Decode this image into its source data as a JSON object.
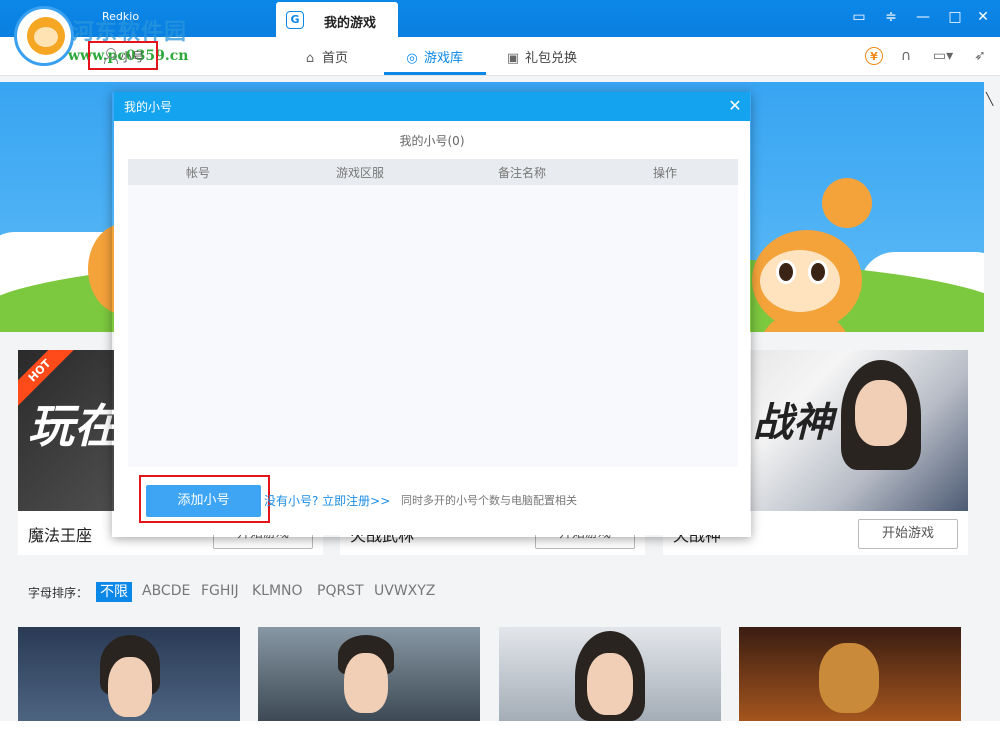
{
  "titlebar": {
    "app_name": "Redkio",
    "active_tab": "我的游戏",
    "tab_icon_letter": "G",
    "controls": [
      "▭",
      "≑",
      "—",
      "□",
      "✕"
    ]
  },
  "watermark": {
    "text": "河东软件园",
    "url": "www.pc0359.cn"
  },
  "navbar": {
    "sub_account": "小号",
    "items": [
      {
        "label": "首页",
        "icon": "home-icon"
      },
      {
        "label": "游戏库",
        "icon": "gamepad-icon"
      },
      {
        "label": "礼包兑换",
        "icon": "gift-icon"
      }
    ],
    "right_icons": [
      "coin-icon",
      "headset-icon",
      "monitor-icon",
      "rocket-icon"
    ],
    "coin_symbol": "¥"
  },
  "games": [
    {
      "title": "魔法王座",
      "button": "开始游戏",
      "badge": "HOT",
      "art_text": "玩在西"
    },
    {
      "title": "火战武林",
      "button": "开始游戏"
    },
    {
      "title": "天战神",
      "button": "开始游戏",
      "art_text": "战神"
    }
  ],
  "filter": {
    "label": "字母排序：",
    "options": [
      "不限",
      "ABCDE",
      "FGHIJ",
      "KLMNO",
      "PQRST",
      "UVWXYZ"
    ],
    "active": "不限"
  },
  "dialog": {
    "title": "我的小号",
    "subtitle": "我的小号(0)",
    "columns": [
      "帐号",
      "游戏区服",
      "备注名称",
      "操作"
    ],
    "add_button": "添加小号",
    "register_link": "没有小号? 立即注册>>",
    "note": "同时多开的小号个数与电脑配置相关"
  },
  "colors": {
    "accent": "#0b87e8",
    "dialog_header": "#14a3ef",
    "highlight": "#e3141b",
    "button": "#3ea5f4"
  }
}
